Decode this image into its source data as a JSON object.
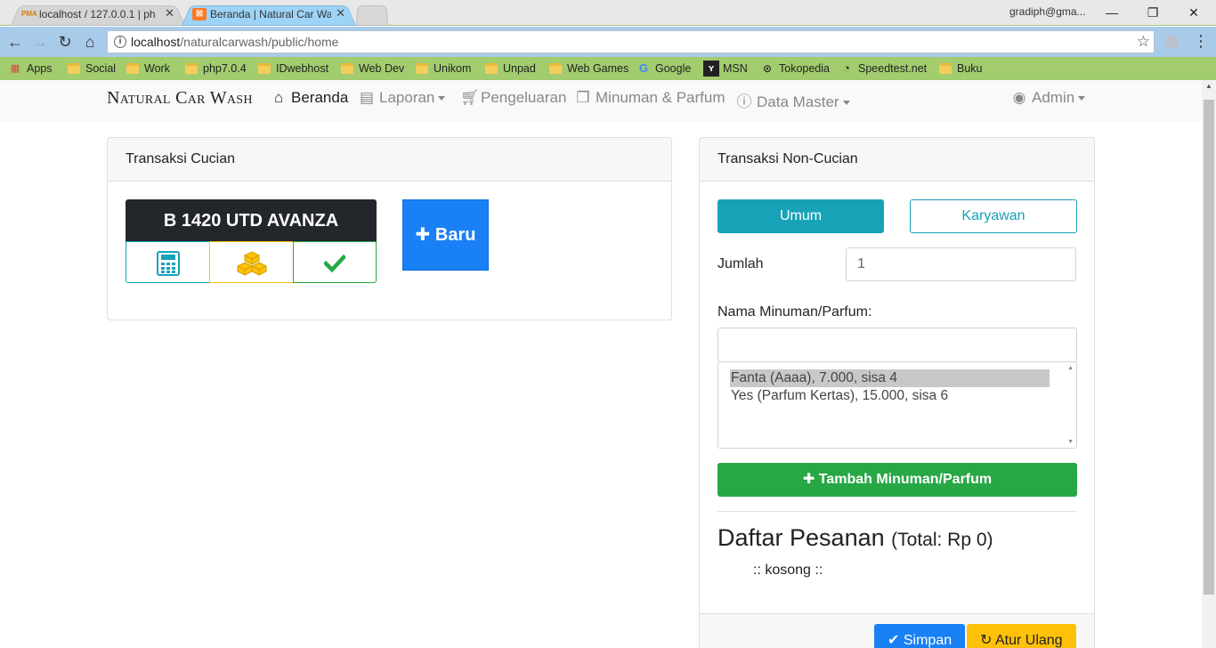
{
  "browser": {
    "tabs": [
      {
        "title": "localhost / 127.0.0.1 | ph",
        "favicon": "pma"
      },
      {
        "title": "Beranda | Natural Car Wa",
        "favicon": "xampp"
      }
    ],
    "profile": "gradiph@gma...",
    "url_host": "localhost",
    "url_path": "/naturalcarwash/public/home",
    "bookmarks": [
      "Apps",
      "Social",
      "Work",
      "php7.0.4",
      "IDwebhost",
      "Web Dev",
      "Unikom",
      "Unpad",
      "Web Games",
      "Google",
      "MSN",
      "Tokopedia",
      "Speedtest.net",
      "Buku"
    ]
  },
  "navbar": {
    "brand": "Natural Car Wash",
    "items": [
      {
        "label": "Beranda",
        "icon": "home-icon"
      },
      {
        "label": "Laporan",
        "icon": "newspaper-icon"
      },
      {
        "label": "Pengeluaran",
        "icon": "cart-icon"
      },
      {
        "label": "Minuman & Parfum",
        "icon": "cubes-icon"
      },
      {
        "label": "Data Master",
        "icon": "info-icon"
      }
    ],
    "user": "Admin"
  },
  "cucian": {
    "title": "Transaksi Cucian",
    "plate": "B 1420 UTD AVANZA",
    "new_button": "Baru"
  },
  "non_cucian": {
    "title": "Transaksi Non-Cucian",
    "btn_umum": "Umum",
    "btn_karyawan": "Karyawan",
    "jumlah_label": "Jumlah",
    "jumlah_value": "1",
    "nama_label": "Nama Minuman/Parfum:",
    "nama_value": "",
    "options": [
      "Fanta (Aaaa), 7.000, sisa 4",
      "Yes (Parfum Kertas), 15.000, sisa 6"
    ],
    "add_button": "Tambah Minuman/Parfum",
    "daftar_title": "Daftar Pesanan",
    "daftar_total": "(Total: Rp 0)",
    "empty": ":: kosong ::",
    "save_button": "Simpan",
    "reset_button": "Atur Ulang"
  },
  "colors": {
    "info": "#17a2b8",
    "primary": "#1a80f5",
    "success": "#28a745",
    "warning": "#ffc107",
    "dark": "#23272b"
  }
}
